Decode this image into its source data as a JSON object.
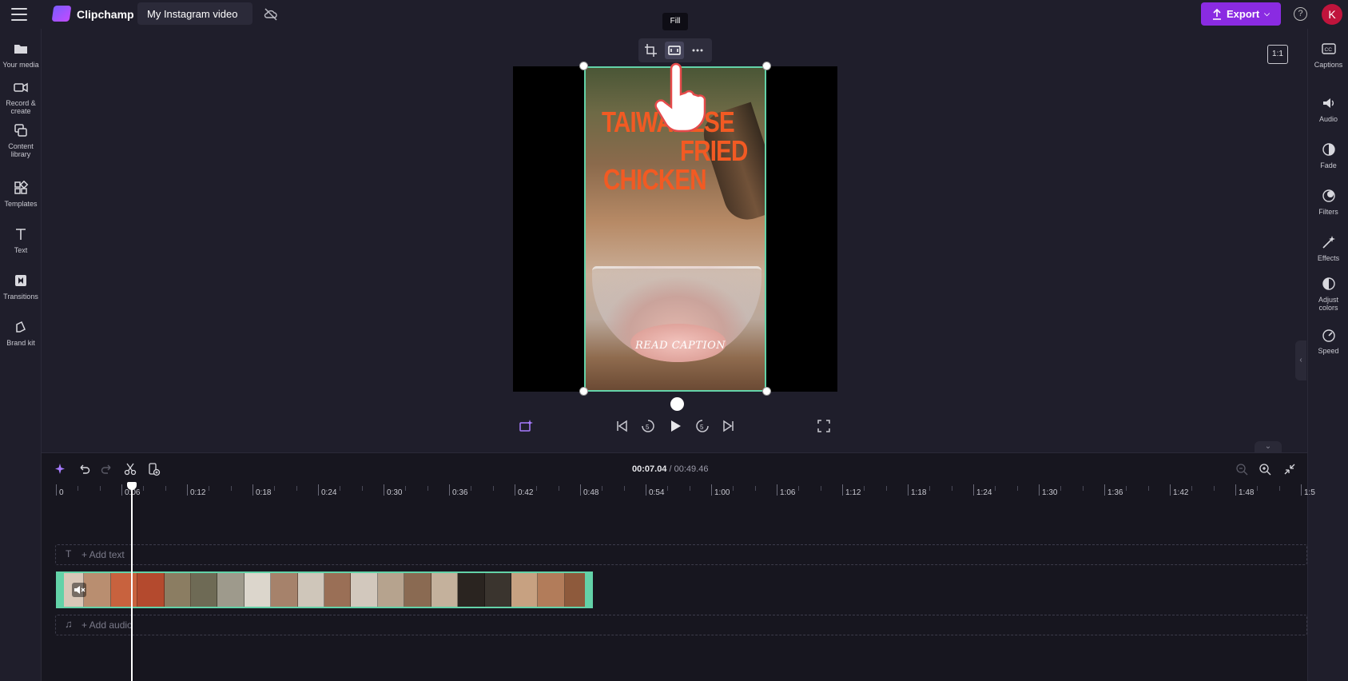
{
  "header": {
    "app_name": "Clipchamp",
    "project_title": "My Instagram video",
    "export_label": "Export",
    "help_label": "?",
    "avatar_initial": "K",
    "brand_color": "#8a2be2"
  },
  "left_sidebar": {
    "items": [
      {
        "label_1": "Your media",
        "label_2": "",
        "icon": "folder-icon"
      },
      {
        "label_1": "Record &",
        "label_2": "create",
        "icon": "camera-icon"
      },
      {
        "label_1": "Content",
        "label_2": "library",
        "icon": "library-icon"
      },
      {
        "label_1": "Templates",
        "label_2": "",
        "icon": "templates-icon"
      },
      {
        "label_1": "Text",
        "label_2": "",
        "icon": "text-icon"
      },
      {
        "label_1": "Transitions",
        "label_2": "",
        "icon": "transitions-icon"
      },
      {
        "label_1": "Brand kit",
        "label_2": "",
        "icon": "brand-kit-icon"
      }
    ]
  },
  "right_sidebar": {
    "items": [
      {
        "label_1": "Captions",
        "label_2": "",
        "icon": "captions-icon"
      },
      {
        "label_1": "Audio",
        "label_2": "",
        "icon": "speaker-icon"
      },
      {
        "label_1": "Fade",
        "label_2": "",
        "icon": "fade-icon"
      },
      {
        "label_1": "Filters",
        "label_2": "",
        "icon": "filters-icon"
      },
      {
        "label_1": "Effects",
        "label_2": "",
        "icon": "effects-icon"
      },
      {
        "label_1": "Adjust",
        "label_2": "colors",
        "icon": "adjust-colors-icon"
      },
      {
        "label_1": "Speed",
        "label_2": "",
        "icon": "speed-icon"
      }
    ]
  },
  "preview": {
    "tooltip": "Fill",
    "aspect_ratio": "1:1",
    "video_title_line1": "TAIWANESE",
    "video_title_line2": "FRIED",
    "video_title_line3": "CHICKEN",
    "video_caption": "READ CAPTION",
    "selection_color": "#63d2a8",
    "title_color": "#f25a23"
  },
  "timeline": {
    "current_time": "00:07.04",
    "total_time": "/ 00:49.46",
    "ticks": [
      "0",
      "0:06",
      "0:12",
      "0:18",
      "0:24",
      "0:30",
      "0:36",
      "0:42",
      "0:48",
      "0:54",
      "1:00",
      "1:06",
      "1:12",
      "1:18",
      "1:24",
      "1:30",
      "1:36",
      "1:42",
      "1:48",
      "1:5"
    ],
    "add_text": "+ Add text",
    "add_audio": "+ Add audio"
  }
}
